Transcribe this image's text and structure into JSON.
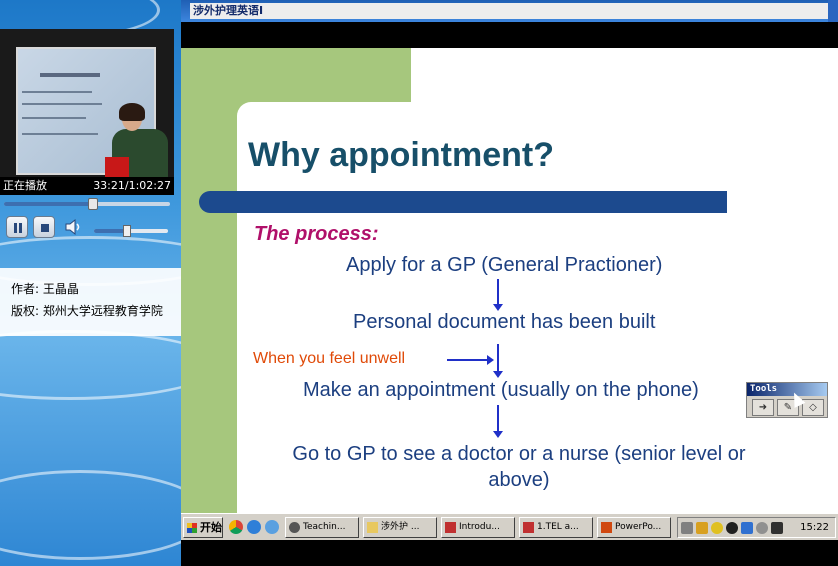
{
  "window": {
    "title": "涉外护理英语I"
  },
  "player": {
    "status": "正在播放",
    "time": "33:21/1:02:27",
    "progress_fraction": 0.534,
    "volume_fraction": 0.45,
    "author_label": "作者:",
    "author": "王晶晶",
    "copyright_label": "版权:",
    "copyright": "郑州大学远程教育学院"
  },
  "slide": {
    "title": "Why appointment?",
    "subtitle": "The process:",
    "steps": [
      "Apply for a GP (General Practioner)",
      "Personal document has been built",
      "Make an appointment (usually on the phone)",
      "Go to GP to see a doctor or a nurse (senior level or above)"
    ],
    "side_note": "When you feel unwell",
    "colors": {
      "title": "#174f69",
      "subtitle": "#b0106a",
      "steps": "#1c3f80",
      "note": "#e04a08",
      "accent_green": "#a6c77d",
      "rule": "#1c4a8e"
    }
  },
  "tools": {
    "title": "Tools",
    "buttons": [
      "arrow-icon",
      "pen-icon",
      "eraser-icon"
    ]
  },
  "taskbar": {
    "start_label": "开始",
    "tasks": [
      {
        "label": "Teachin...",
        "icon": "browser-icon"
      },
      {
        "label": "涉外护 ...",
        "icon": "folder-icon"
      },
      {
        "label": "Introdu...",
        "icon": "word-icon"
      },
      {
        "label": "1.TEL a...",
        "icon": "word-icon"
      },
      {
        "label": "PowerPo...",
        "icon": "powerpoint-icon"
      }
    ],
    "clock": "15:22"
  }
}
